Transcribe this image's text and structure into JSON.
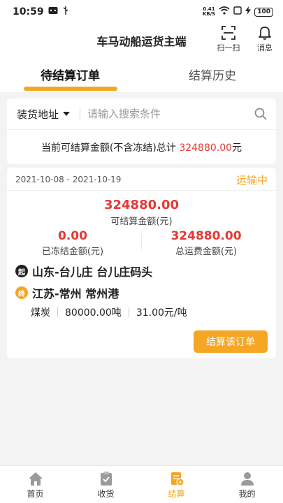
{
  "status_bar": {
    "time": "10:59",
    "net_speed_value": "0.41",
    "net_speed_unit": "KB/S",
    "battery": "100"
  },
  "header": {
    "title": "车马动船运货主端",
    "scan_label": "扫一扫",
    "message_label": "消息"
  },
  "tabs": [
    {
      "label": "待结算订单",
      "active": true
    },
    {
      "label": "结算历史",
      "active": false
    }
  ],
  "search": {
    "field_label": "装货地址",
    "placeholder": "请输入搜索条件"
  },
  "summary": {
    "prefix": "当前可结算金额(不含冻结)总计",
    "amount": "324880.00",
    "unit": "元"
  },
  "order": {
    "date_range": "2021-10-08 - 2021-10-19",
    "status": "运输中",
    "settleable_amount": "324880.00",
    "settleable_label": "可结算金额(元)",
    "frozen_amount": "0.00",
    "frozen_label": "已冻结金额(元)",
    "total_freight": "324880.00",
    "total_freight_label": "总运费金额(元)",
    "from_badge": "起",
    "from": "山东-台儿庄 台儿庄码头",
    "to_badge": "终",
    "to": "江苏-常州 常州港",
    "cargo": "煤炭",
    "weight": "80000.00吨",
    "price": "31.00元/吨",
    "settle_button": "结算该订单"
  },
  "bottom_nav": [
    {
      "label": "首页",
      "icon": "home-icon"
    },
    {
      "label": "收货",
      "icon": "receive-icon"
    },
    {
      "label": "结算",
      "icon": "settle-icon",
      "active": true
    },
    {
      "label": "我的",
      "icon": "profile-icon"
    }
  ],
  "colors": {
    "accent": "#f5a623",
    "amount_red": "#e53935",
    "background": "#f3f3f3"
  }
}
